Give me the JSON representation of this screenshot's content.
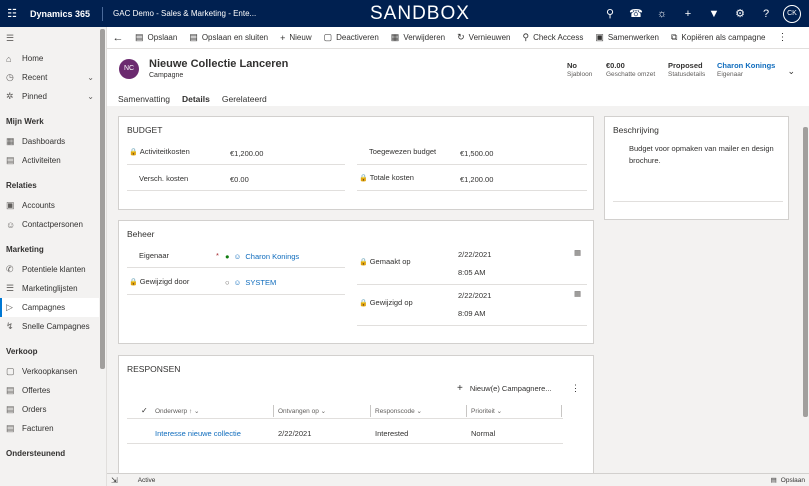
{
  "topbar": {
    "waffle_icon": "waffle-icon",
    "app_name": "Dynamics 365",
    "area_name": "GAC Demo - Sales & Marketing - Ente...",
    "environment": "SANDBOX",
    "user_initials": "CK"
  },
  "sidebar": {
    "top_items": [
      {
        "label": "Home",
        "icon": "home-icon"
      },
      {
        "label": "Recent",
        "icon": "clock-icon"
      },
      {
        "label": "Pinned",
        "icon": "pin-icon"
      }
    ],
    "groups": [
      {
        "title": "Mijn Werk",
        "items": [
          "Dashboards",
          "Activiteiten"
        ]
      },
      {
        "title": "Relaties",
        "items": [
          "Accounts",
          "Contactpersonen"
        ]
      },
      {
        "title": "Marketing",
        "items": [
          "Potentiele klanten",
          "Marketinglijsten",
          "Campagnes",
          "Snelle Campagnes"
        ]
      },
      {
        "title": "Verkoop",
        "items": [
          "Verkoopkansen",
          "Offertes",
          "Orders",
          "Facturen"
        ]
      },
      {
        "title": "Ondersteunend",
        "items": []
      }
    ]
  },
  "commands": [
    "Opslaan",
    "Opslaan en sluiten",
    "Nieuw",
    "Deactiveren",
    "Verwijderen",
    "Vernieuwen",
    "Check Access",
    "Samenwerken",
    "Kopiëren als campagne"
  ],
  "record": {
    "initials": "NC",
    "avatar_color": "#6b2a6f",
    "title": "Nieuwe Collectie Lanceren",
    "type": "Campagne",
    "header_fields": [
      {
        "value": "No",
        "label": "Sjabloon"
      },
      {
        "value": "€0.00",
        "label": "Geschatte omzet"
      },
      {
        "value": "Proposed",
        "label": "Statusdetails"
      },
      {
        "value": "Charon Konings",
        "label": "Eigenaar"
      }
    ],
    "tabs": [
      "Samenvatting",
      "Details",
      "Gerelateerd"
    ],
    "active_tab": "Details"
  },
  "budget": {
    "title": "BUDGET",
    "activity_costs_label": "Activiteitkosten",
    "activity_costs_value": "€1,200.00",
    "misc_costs_label": "Versch. kosten",
    "misc_costs_value": "€0.00",
    "allocated_label": "Toegewezen budget",
    "allocated_value": "€1,500.00",
    "total_label": "Totale kosten",
    "total_value": "€1,200.00"
  },
  "description": {
    "title": "Beschrijving",
    "text": "Budget voor opmaken van mailer en design brochure."
  },
  "beheer": {
    "title": "Beheer",
    "owner_label": "Eigenaar",
    "owner_required": "*",
    "owner_value": "Charon Konings",
    "modified_by_label": "Gewijzigd door",
    "modified_by_value": "SYSTEM",
    "created_label": "Gemaakt op",
    "created_date": "2/22/2021",
    "created_time": "8:05 AM",
    "modified_label": "Gewijzigd op",
    "modified_date": "2/22/2021",
    "modified_time": "8:09 AM"
  },
  "responses": {
    "title": "RESPONSEN",
    "new_button": "Nieuw(e) Campagnere...",
    "columns": [
      "Onderwerp",
      "Ontvangen op",
      "Responscode",
      "Prioriteit"
    ],
    "rows": [
      {
        "subject": "Interesse nieuwe collectie",
        "received": "2/22/2021",
        "code": "Interested",
        "priority": "Normal"
      }
    ]
  },
  "status": {
    "state": "Active",
    "save_label": "Opslaan"
  }
}
